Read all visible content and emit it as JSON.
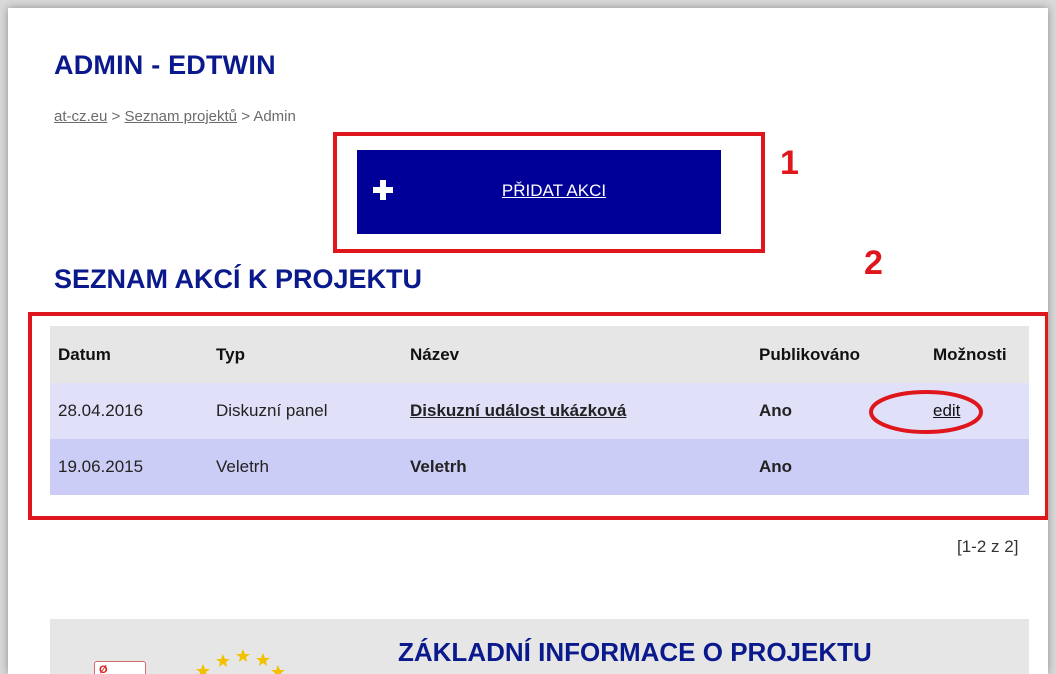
{
  "header": {
    "title": "ADMIN - EDTWIN"
  },
  "breadcrumb": {
    "home": "at-cz.eu",
    "sep1": ">",
    "projects": "Seznam projektů",
    "sep2": ">",
    "current": "Admin"
  },
  "add_button": {
    "icon": "plus-icon",
    "label": "PŘIDAT AKCI"
  },
  "annotations": {
    "label1": "1",
    "label2": "2",
    "color": "#e0161d"
  },
  "section": {
    "title": "SEZNAM AKCÍ K PROJEKTU"
  },
  "table": {
    "headers": [
      "Datum",
      "Typ",
      "Název",
      "Publikováno",
      "Možnosti"
    ],
    "rows": [
      {
        "date": "28.04.2016",
        "type": "Diskuzní panel",
        "name": "Diskuzní událost ukázková",
        "published": "Ano",
        "option": "edit"
      },
      {
        "date": "19.06.2015",
        "type": "Veletrh",
        "name": "Veletrh",
        "published": "Ano",
        "option": ""
      }
    ]
  },
  "pagination": {
    "text": "[1-2 z 2]"
  },
  "info": {
    "title": "ZÁKLADNÍ INFORMACE O PROJEKTU"
  },
  "colors": {
    "brand_blue": "#000099",
    "title_blue": "#0a1a8c",
    "published_green": "#1a7f1a",
    "row1": "#e0e0f8",
    "row2": "#cccdf6"
  }
}
